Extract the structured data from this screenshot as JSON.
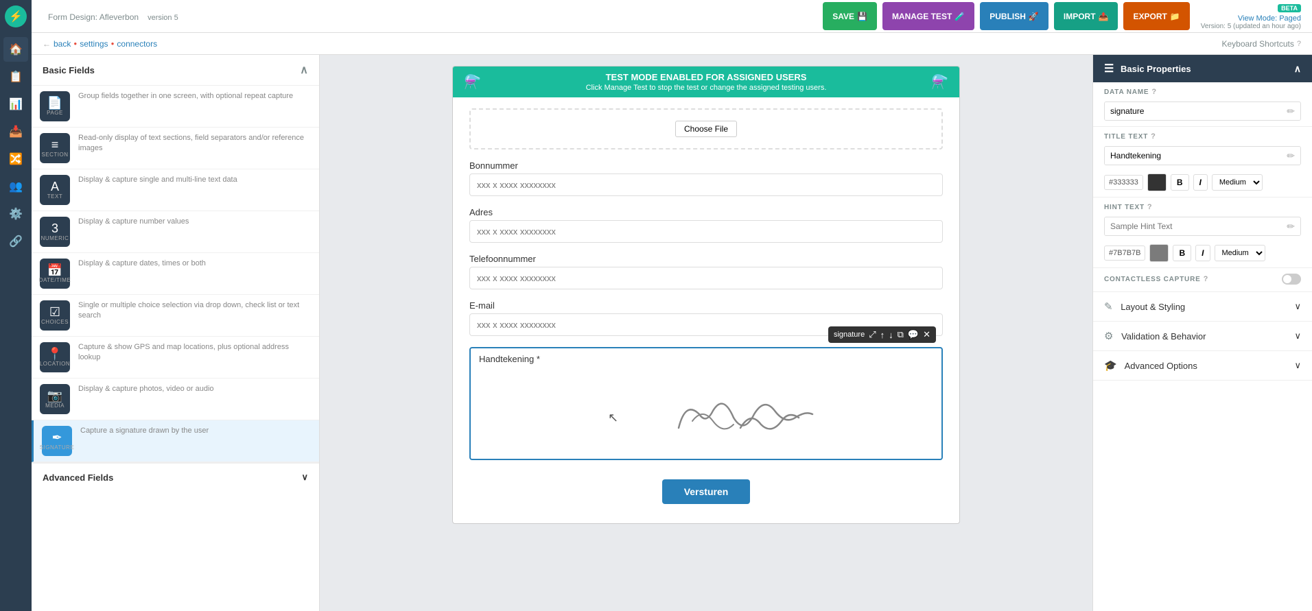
{
  "app": {
    "title": "Form Design: Afleverbon",
    "version": "version 5",
    "version_info": "Version: 5 (updated an hour ago)",
    "view_mode": "View Mode: Paged",
    "beta_label": "BETA"
  },
  "breadcrumb": {
    "back": "back",
    "settings": "settings",
    "connectors": "connectors"
  },
  "keyboard_shortcuts": "Keyboard Shortcuts",
  "header_buttons": {
    "save": "SAVE",
    "manage_test": "MANAGE TEST",
    "publish": "PUBLISH",
    "import": "IMPORT",
    "export": "EXPORT"
  },
  "left_panel": {
    "basic_fields_title": "Basic Fields",
    "advanced_fields_title": "Advanced Fields",
    "fields": [
      {
        "icon": "📄",
        "label": "PAGE",
        "title": "Page",
        "desc": "Group fields together in one screen, with optional repeat capture"
      },
      {
        "icon": "≡",
        "label": "SECTION",
        "title": "Section",
        "desc": "Read-only display of text sections, field separators and/or reference images"
      },
      {
        "icon": "A",
        "label": "TEXT",
        "title": "Text",
        "desc": "Display & capture single and multi-line text data"
      },
      {
        "icon": "3",
        "label": "NUMERIC",
        "title": "Numeric",
        "desc": "Display & capture number values"
      },
      {
        "icon": "📅",
        "label": "DATE/TIME",
        "title": "Date/Time",
        "desc": "Display & capture dates, times or both"
      },
      {
        "icon": "☑",
        "label": "CHOICES",
        "title": "Choices",
        "desc": "Single or multiple choice selection via drop down, check list or text search"
      },
      {
        "icon": "📍",
        "label": "LOCATION",
        "title": "Location",
        "desc": "Capture & show GPS and map locations, plus optional address lookup"
      },
      {
        "icon": "📷",
        "label": "MEDIA",
        "title": "Media",
        "desc": "Display & capture photos, video or audio"
      },
      {
        "icon": "✒",
        "label": "SIGNATURE",
        "title": "Signature",
        "desc": "Capture a signature drawn by the user",
        "active": true
      }
    ]
  },
  "test_banner": {
    "title": "TEST MODE ENABLED FOR ASSIGNED USERS",
    "subtitle": "Click Manage Test to stop the test or change the assigned testing users.",
    "help": "?"
  },
  "form": {
    "file_upload_label": "Choose File",
    "fields": [
      {
        "label": "Bonnummer",
        "placeholder": "xxx x xxxx xxxxxxxx"
      },
      {
        "label": "Adres",
        "placeholder": "xxx x xxxx xxxxxxxx"
      },
      {
        "label": "Telefoonnummer",
        "placeholder": "xxx x xxxx xxxxxxxx"
      },
      {
        "label": "E-mail",
        "placeholder": "xxx x xxxx xxxxxxxx"
      }
    ],
    "signature_label": "Handtekening *",
    "signature_toolbar": {
      "name": "signature",
      "up": "↑",
      "down": "↓",
      "copy": "⧉",
      "comment": "💬",
      "close": "✕"
    },
    "submit_button": "Versturen"
  },
  "right_panel": {
    "basic_properties_title": "Basic Properties",
    "data_name_label": "DATA NAME",
    "data_name_value": "signature",
    "title_text_label": "TITLE TEXT",
    "title_text_value": "Handtekening",
    "title_color": "#333333",
    "title_size": "Medium",
    "hint_text_label": "HINT TEXT",
    "hint_text_placeholder": "Sample Hint Text",
    "hint_color": "#7B7B7B",
    "hint_size": "Medium",
    "contactless_label": "CONTACTLESS CAPTURE",
    "layout_styling_title": "Layout & Styling",
    "validation_behavior_title": "Validation & Behavior",
    "advanced_options_title": "Advanced Options"
  }
}
